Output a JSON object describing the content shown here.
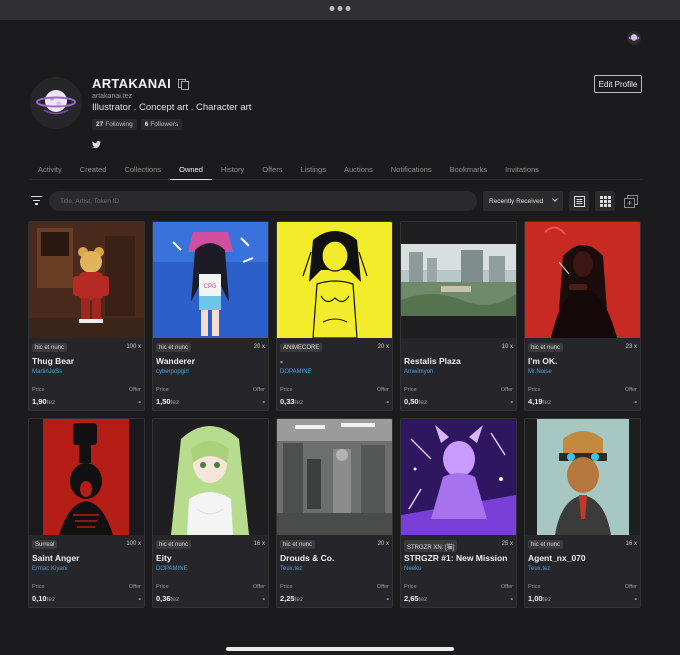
{
  "profile": {
    "name": "ARTAKANAI",
    "handle": "artakanai.tez",
    "bio": "Illustrator . Concept art . Character art",
    "following_count": "27",
    "following_label": "Following",
    "followers_count": "6",
    "followers_label": "Followers",
    "edit_label": "Edit Profile"
  },
  "tabs": [
    {
      "label": "Activity"
    },
    {
      "label": "Created"
    },
    {
      "label": "Collections"
    },
    {
      "label": "Owned",
      "active": true
    },
    {
      "label": "History"
    },
    {
      "label": "Offers"
    },
    {
      "label": "Listings"
    },
    {
      "label": "Auctions"
    },
    {
      "label": "Notifications"
    },
    {
      "label": "Bookmarks"
    },
    {
      "label": "Invitations"
    }
  ],
  "toolbar": {
    "search_placeholder": "Title, Artist, Token ID",
    "sort_value": "Recently Received"
  },
  "card_labels": {
    "price": "Price",
    "offer": "Offer",
    "currency": "tez"
  },
  "cards": [
    {
      "badge": "hic et nunc",
      "editions": "100 x",
      "title": "Thug Bear",
      "artist": "MartinJoSs",
      "price": "1,90",
      "offer": "-"
    },
    {
      "badge": "hic et nunc",
      "editions": "20 x",
      "title": "Wanderer",
      "artist": "cyberpopgirl",
      "price": "1,50",
      "offer": "-"
    },
    {
      "badge": "ANIMECORE",
      "editions": "20 x",
      "title": "-",
      "artist": "DOPAMINE",
      "price": "0,33",
      "offer": "-"
    },
    {
      "badge": "",
      "editions": "10 x",
      "title": "Restalis Plaza",
      "artist": "Amwimyoh",
      "price": "0,50",
      "offer": "-"
    },
    {
      "badge": "hic et nunc",
      "editions": "23 x",
      "title": "I'm OK.",
      "artist": "Mr.Noise",
      "price": "4,19",
      "offer": "-"
    },
    {
      "badge": "Surreal",
      "editions": "100 x",
      "title": "Saint Anger",
      "artist": "Ermac Kiyani",
      "price": "0,10",
      "offer": "-"
    },
    {
      "badge": "hic et nunc",
      "editions": "16 x",
      "title": "Eity",
      "artist": "DOPAMINE",
      "price": "0,36",
      "offer": "-"
    },
    {
      "badge": "hic et nunc",
      "editions": "20 x",
      "title": "Drouds & Co.",
      "artist": "Teux.tez",
      "price": "2,25",
      "offer": "-"
    },
    {
      "badge": "STRGZR XN: [猫]",
      "editions": "25 x",
      "title": "STRGZR #1: New Mission",
      "artist": "Neeku",
      "price": "2,65",
      "offer": "-"
    },
    {
      "badge": "hic et nunc",
      "editions": "16 x",
      "title": "Agent_nx_070",
      "artist": "Teux.tez",
      "price": "1,00",
      "offer": "-"
    }
  ]
}
